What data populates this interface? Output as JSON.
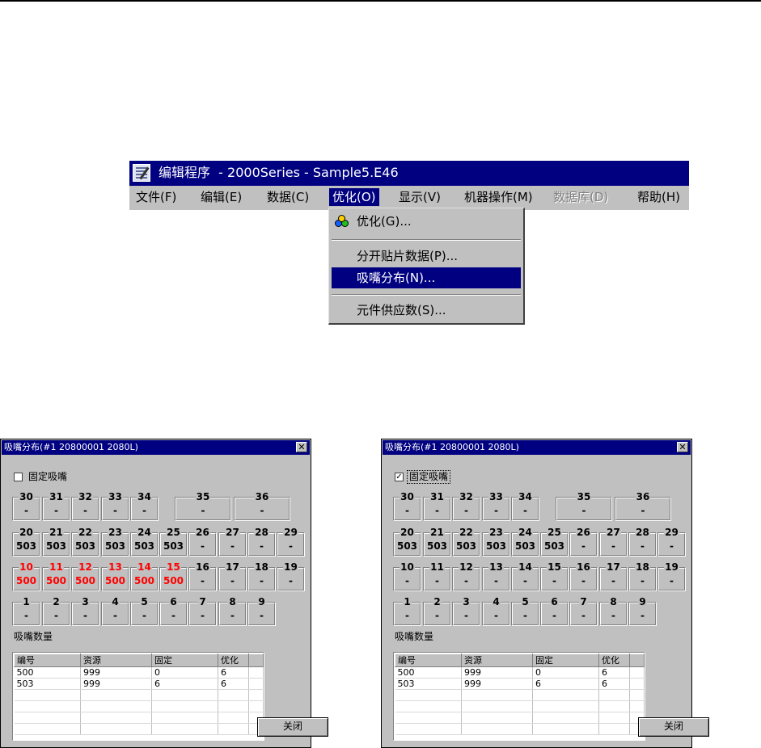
{
  "main_window": {
    "title": "编辑程序  - 2000Series - Sample5.E46",
    "menu": [
      {
        "label": "文件(F)",
        "state": "normal"
      },
      {
        "label": "编辑(E)",
        "state": "normal"
      },
      {
        "label": "数据(C)",
        "state": "normal"
      },
      {
        "label": "优化(O)",
        "state": "active"
      },
      {
        "label": "显示(V)",
        "state": "normal"
      },
      {
        "label": "机器操作(M)",
        "state": "normal"
      },
      {
        "label": "数据库(D)",
        "state": "disabled"
      },
      {
        "label": "帮助(H)",
        "state": "normal"
      }
    ],
    "dropdown": [
      {
        "label": "优化(G)...",
        "icon": "optimize-icon"
      },
      {
        "label": "分开贴片数据(P)..."
      },
      {
        "label": "吸嘴分布(N)...",
        "highlighted": true
      },
      {
        "label": "元件供应数(S)..."
      }
    ]
  },
  "dialogs": [
    {
      "title": "吸嘴分布(#1 20800001 2080L)",
      "fix_label": "固定吸嘴",
      "fix_checked": false,
      "nozzles": [
        {
          "no": "30",
          "val": "-"
        },
        {
          "no": "31",
          "val": "-"
        },
        {
          "no": "32",
          "val": "-"
        },
        {
          "no": "33",
          "val": "-"
        },
        {
          "no": "34",
          "val": "-"
        },
        {
          "no": "35",
          "val": "-"
        },
        {
          "no": "36",
          "val": "-"
        },
        {
          "no": "20",
          "val": "503"
        },
        {
          "no": "21",
          "val": "503"
        },
        {
          "no": "22",
          "val": "503"
        },
        {
          "no": "23",
          "val": "503"
        },
        {
          "no": "24",
          "val": "503"
        },
        {
          "no": "25",
          "val": "503"
        },
        {
          "no": "26",
          "val": "-"
        },
        {
          "no": "27",
          "val": "-"
        },
        {
          "no": "28",
          "val": "-"
        },
        {
          "no": "29",
          "val": "-"
        },
        {
          "no": "10",
          "val": "500",
          "red": true
        },
        {
          "no": "11",
          "val": "500",
          "red": true
        },
        {
          "no": "12",
          "val": "500",
          "red": true
        },
        {
          "no": "13",
          "val": "500",
          "red": true
        },
        {
          "no": "14",
          "val": "500",
          "red": true
        },
        {
          "no": "15",
          "val": "500",
          "red": true
        },
        {
          "no": "16",
          "val": "-"
        },
        {
          "no": "17",
          "val": "-"
        },
        {
          "no": "18",
          "val": "-"
        },
        {
          "no": "19",
          "val": "-"
        },
        {
          "no": "1",
          "val": "-"
        },
        {
          "no": "2",
          "val": "-"
        },
        {
          "no": "3",
          "val": "-"
        },
        {
          "no": "4",
          "val": "-"
        },
        {
          "no": "5",
          "val": "-"
        },
        {
          "no": "6",
          "val": "-"
        },
        {
          "no": "7",
          "val": "-"
        },
        {
          "no": "8",
          "val": "-"
        },
        {
          "no": "9",
          "val": "-"
        }
      ],
      "count_label": "吸嘴数量",
      "table": {
        "headers": [
          "编号",
          "资源",
          "固定",
          "优化"
        ],
        "rows": [
          [
            "500",
            "999",
            "0",
            "6"
          ],
          [
            "503",
            "999",
            "6",
            "6"
          ]
        ]
      },
      "close_label": "关闭"
    },
    {
      "title": "吸嘴分布(#1 20800001 2080L)",
      "fix_label": "固定吸嘴",
      "fix_checked": true,
      "nozzles": [
        {
          "no": "30",
          "val": "-"
        },
        {
          "no": "31",
          "val": "-"
        },
        {
          "no": "32",
          "val": "-"
        },
        {
          "no": "33",
          "val": "-"
        },
        {
          "no": "34",
          "val": "-"
        },
        {
          "no": "35",
          "val": "-"
        },
        {
          "no": "36",
          "val": "-"
        },
        {
          "no": "20",
          "val": "503"
        },
        {
          "no": "21",
          "val": "503"
        },
        {
          "no": "22",
          "val": "503"
        },
        {
          "no": "23",
          "val": "503"
        },
        {
          "no": "24",
          "val": "503"
        },
        {
          "no": "25",
          "val": "503"
        },
        {
          "no": "26",
          "val": "-"
        },
        {
          "no": "27",
          "val": "-"
        },
        {
          "no": "28",
          "val": "-"
        },
        {
          "no": "29",
          "val": "-"
        },
        {
          "no": "10",
          "val": "-"
        },
        {
          "no": "11",
          "val": "-"
        },
        {
          "no": "12",
          "val": "-"
        },
        {
          "no": "13",
          "val": "-"
        },
        {
          "no": "14",
          "val": "-"
        },
        {
          "no": "15",
          "val": "-"
        },
        {
          "no": "16",
          "val": "-"
        },
        {
          "no": "17",
          "val": "-"
        },
        {
          "no": "18",
          "val": "-"
        },
        {
          "no": "19",
          "val": "-"
        },
        {
          "no": "1",
          "val": "-"
        },
        {
          "no": "2",
          "val": "-"
        },
        {
          "no": "3",
          "val": "-"
        },
        {
          "no": "4",
          "val": "-"
        },
        {
          "no": "5",
          "val": "-"
        },
        {
          "no": "6",
          "val": "-"
        },
        {
          "no": "7",
          "val": "-"
        },
        {
          "no": "8",
          "val": "-"
        },
        {
          "no": "9",
          "val": "-"
        }
      ],
      "count_label": "吸嘴数量",
      "table": {
        "headers": [
          "编号",
          "资源",
          "固定",
          "优化"
        ],
        "rows": [
          [
            "500",
            "999",
            "0",
            "6"
          ],
          [
            "503",
            "999",
            "6",
            "6"
          ]
        ]
      },
      "close_label": "关闭"
    }
  ]
}
